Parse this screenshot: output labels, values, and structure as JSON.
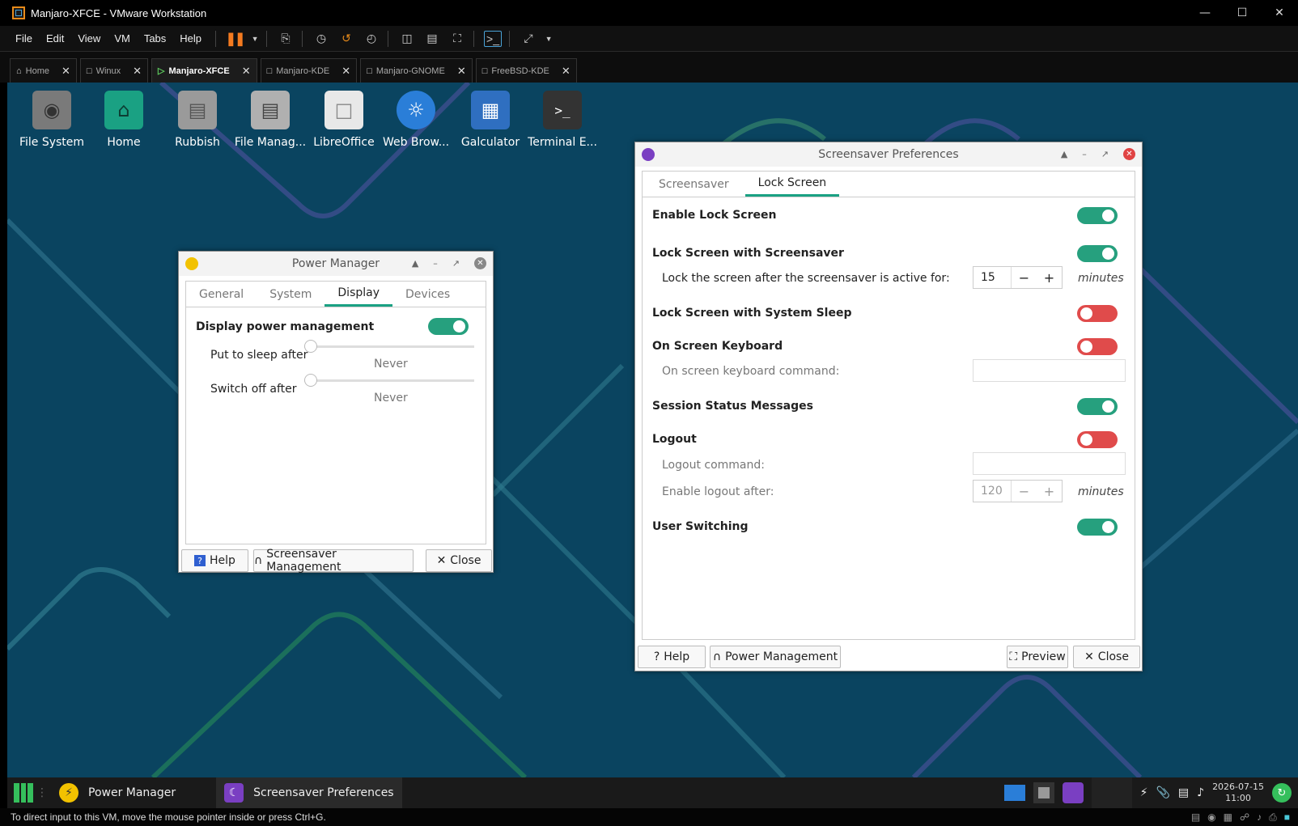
{
  "vmware": {
    "window_title": "Manjaro-XFCE - VMware Workstation",
    "menu": [
      "File",
      "Edit",
      "View",
      "VM",
      "Tabs",
      "Help"
    ],
    "tabs": [
      {
        "label": "Home",
        "active": false
      },
      {
        "label": "Winux",
        "active": false
      },
      {
        "label": "Manjaro-XFCE",
        "active": true
      },
      {
        "label": "Manjaro-KDE",
        "active": false
      },
      {
        "label": "Manjaro-GNOME",
        "active": false
      },
      {
        "label": "FreeBSD-KDE",
        "active": false
      }
    ],
    "status_message": "To direct input to this VM, move the mouse pointer inside or press Ctrl+G."
  },
  "desktop_icons": [
    {
      "label": "File System",
      "icon": "drive-icon",
      "color": "#7a7a7a"
    },
    {
      "label": "Home",
      "icon": "home-folder-icon",
      "color": "#1aa183"
    },
    {
      "label": "Rubbish",
      "icon": "trash-icon",
      "color": "#9a9a9a"
    },
    {
      "label": "File Manag...",
      "icon": "file-manager-icon",
      "color": "#b0b0b0"
    },
    {
      "label": "LibreOffice",
      "icon": "document-icon",
      "color": "#e8e8e8"
    },
    {
      "label": "Web Brow...",
      "icon": "browser-icon",
      "color": "#2a7ed8"
    },
    {
      "label": "Galculator",
      "icon": "calculator-icon",
      "color": "#2f6fc0"
    },
    {
      "label": "Terminal E...",
      "icon": "terminal-icon",
      "color": "#333333"
    }
  ],
  "power_manager": {
    "title": "Power Manager",
    "tabs": [
      "General",
      "System",
      "Display",
      "Devices"
    ],
    "selected_tab": "Display",
    "display_power_management_label": "Display power management",
    "display_power_management_on": true,
    "sleep_label": "Put to sleep after",
    "sleep_value": "Never",
    "sleep_level": 0,
    "switch_off_label": "Switch off after",
    "switch_off_value": "Never",
    "switch_off_level": 0,
    "buttons": {
      "help": "Help",
      "screensaver": "Screensaver Management",
      "close": "Close"
    }
  },
  "screensaver": {
    "title": "Screensaver Preferences",
    "tabs": [
      "Screensaver",
      "Lock Screen"
    ],
    "selected_tab": "Lock Screen",
    "enable_lock_screen": {
      "label": "Enable Lock Screen",
      "on": true
    },
    "lock_with_screensaver": {
      "label": "Lock Screen with Screensaver",
      "on": true
    },
    "lock_after": {
      "label": "Lock the screen after the screensaver is active for:",
      "value": "15",
      "unit": "minutes"
    },
    "lock_with_sleep": {
      "label": "Lock Screen with System Sleep",
      "on": false
    },
    "osk": {
      "label": "On Screen Keyboard",
      "on": false
    },
    "osk_command": {
      "label": "On screen keyboard command:",
      "value": ""
    },
    "session_status": {
      "label": "Session Status Messages",
      "on": true
    },
    "logout": {
      "label": "Logout",
      "on": false
    },
    "logout_command": {
      "label": "Logout command:",
      "value": ""
    },
    "logout_after": {
      "label": "Enable logout after:",
      "value": "120",
      "unit": "minutes"
    },
    "user_switching": {
      "label": "User Switching",
      "on": true
    },
    "buttons": {
      "help": "Help",
      "power": "Power Management",
      "preview": "Preview",
      "close": "Close"
    }
  },
  "taskbar": {
    "tasks": [
      "Power Manager",
      "Screensaver Preferences"
    ],
    "date": "2026-07-15",
    "time": "11:00"
  }
}
